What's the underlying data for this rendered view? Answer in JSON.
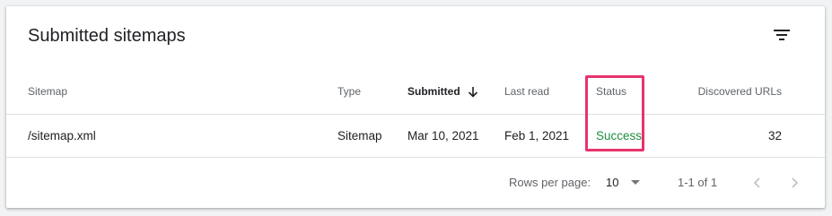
{
  "card": {
    "title": "Submitted sitemaps"
  },
  "table": {
    "columns": [
      {
        "label": "Sitemap"
      },
      {
        "label": "Type"
      },
      {
        "label": "Submitted",
        "sorted": "descending"
      },
      {
        "label": "Last read"
      },
      {
        "label": "Status"
      },
      {
        "label": "Discovered URLs"
      }
    ],
    "rows": [
      {
        "sitemap": "/sitemap.xml",
        "type": "Sitemap",
        "submitted": "Mar 10, 2021",
        "last_read": "Feb 1, 2021",
        "status": "Success",
        "discovered_urls": "32"
      }
    ]
  },
  "pagination": {
    "rows_per_page_label": "Rows per page:",
    "rows_per_page_value": "10",
    "range_text": "1-1 of 1"
  },
  "icons": {
    "filter": "filter-list-icon",
    "sort": "arrow-downward-icon",
    "caret": "dropdown-caret-icon",
    "prev": "chevron-left-icon",
    "next": "chevron-right-icon"
  },
  "colors": {
    "success": "#1e8e3e",
    "highlight": "#e8336d"
  }
}
